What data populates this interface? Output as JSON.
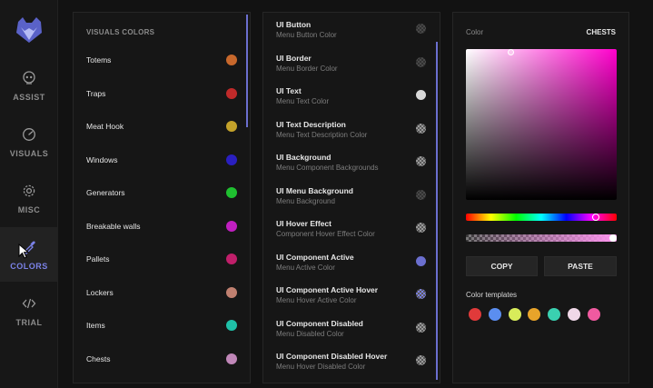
{
  "sidebar": {
    "logo": "fox-logo",
    "items": [
      {
        "label": "ASSIST",
        "icon": "skull-icon",
        "active": false
      },
      {
        "label": "VISUALS",
        "icon": "gauge-icon",
        "active": false
      },
      {
        "label": "MISC",
        "icon": "gear-icon",
        "active": false
      },
      {
        "label": "COLORS",
        "icon": "eyedropper-icon",
        "active": true
      },
      {
        "label": "TRIAL",
        "icon": "code-icon",
        "active": false
      }
    ],
    "accent": "#7b82e8"
  },
  "visuals": {
    "title": "VISUALS COLORS",
    "items": [
      {
        "name": "Totems",
        "color": "#c8682c"
      },
      {
        "name": "Traps",
        "color": "#c02a2a"
      },
      {
        "name": "Meat Hook",
        "color": "#c4a22a"
      },
      {
        "name": "Windows",
        "color": "#2a1fc0"
      },
      {
        "name": "Generators",
        "color": "#1fc030"
      },
      {
        "name": "Breakable walls",
        "color": "#c01fc0"
      },
      {
        "name": "Pallets",
        "color": "#c01f6a"
      },
      {
        "name": "Lockers",
        "color": "#c08070"
      },
      {
        "name": "Items",
        "color": "#1fc0a8"
      },
      {
        "name": "Chests",
        "color": "#c087b8"
      }
    ]
  },
  "ui_colors": {
    "items": [
      {
        "name": "UI Button",
        "sub": "Menu Button Color",
        "swatch": "checker-dark"
      },
      {
        "name": "UI Border",
        "sub": "Menu Border Color",
        "swatch": "checker-dark"
      },
      {
        "name": "UI Text",
        "sub": "Menu Text Color",
        "swatch": "#d8d8d8"
      },
      {
        "name": "UI Text Description",
        "sub": "Menu Text Description Color",
        "swatch": "checker"
      },
      {
        "name": "UI Background",
        "sub": "Menu Component Backgrounds",
        "swatch": "checker"
      },
      {
        "name": "UI Menu Background",
        "sub": "Menu Background",
        "swatch": "checker-dark"
      },
      {
        "name": "UI Hover Effect",
        "sub": "Component Hover Effect Color",
        "swatch": "checker"
      },
      {
        "name": "UI Component Active",
        "sub": "Menu Active Color",
        "swatch": "#6b6fcf"
      },
      {
        "name": "UI Component Active Hover",
        "sub": "Menu Hover Active Color",
        "swatch": "checker-blue"
      },
      {
        "name": "UI Component Disabled",
        "sub": "Menu Disabled Color",
        "swatch": "checker"
      },
      {
        "name": "UI Component Disabled Hover",
        "sub": "Menu Hover Disabled Color",
        "swatch": "checker"
      }
    ]
  },
  "picker": {
    "label": "Color",
    "target": "CHESTS",
    "hue_color": "#ff00cc",
    "hue_fraction": 0.86,
    "alpha_fraction": 1.0,
    "copy_label": "COPY",
    "paste_label": "PASTE",
    "templates_label": "Color templates",
    "templates": [
      "#e03a3a",
      "#5b8ef0",
      "#d8ec5a",
      "#e8a42a",
      "#3ad0b0",
      "#f0d8e8",
      "#f05aa0"
    ]
  }
}
